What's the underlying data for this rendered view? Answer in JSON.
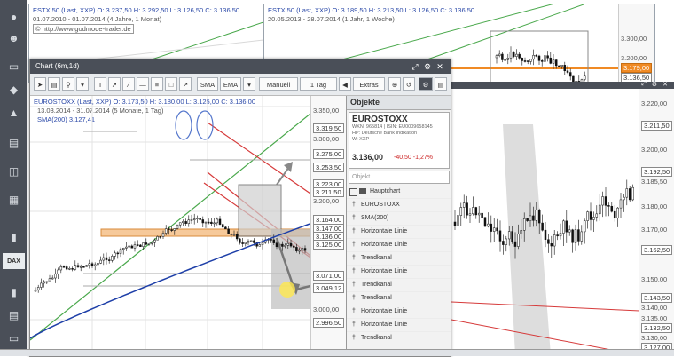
{
  "main_window": {
    "title": "Chart (6m,1d)",
    "toolbar": {
      "sma_label": "SMA",
      "ema_label": "EMA",
      "mode_label": "Manuell",
      "interval_label": "1 Tag",
      "extras_label": "Extras"
    },
    "info": {
      "line1": "EUROSTOXX (Last, XXP) O: 3.173,50 H: 3.180,00 L: 3.125,00 C: 3.136,00",
      "line2": "13.03.2014 - 31.07.2014 (5 Monate, 1 Tag)",
      "line3": "SMA(200)   3.127,41"
    },
    "price_labels": [
      "3.350,00",
      "3.319,50",
      "3.300,00",
      "3.275,00",
      "3.253,50",
      "3.223,00",
      "3.211,50",
      "3.200,00",
      "3.164,00",
      "3.147,00",
      "3.136,00",
      "3.125,00",
      "3.071,00",
      "3.049,12",
      "3.000,00",
      "2.996,50"
    ]
  },
  "objects_panel": {
    "title": "Objekte",
    "symbol": "EUROSTOXX",
    "wkn_line": "WKN: 965814 | ISIN: EU0009658145",
    "hp_line": "HP: Deutsche Bank Indikation",
    "w_line": "W: XXP",
    "price": "3.136,00",
    "change": "-40,50  -1,27%",
    "search_placeholder": "Objekt",
    "tree_root": "Hauptchart",
    "items": [
      "EUROSTOXX",
      "SMA(200)",
      "Horizontale Linie",
      "Horizontale Linie",
      "Trendkanal",
      "Horizontale Linie",
      "Trendkanal",
      "Trendkanal",
      "Horizontale Linie",
      "Horizontale Linie",
      "Trendkanal"
    ]
  },
  "bg_left_window": {
    "info_line1": "ESTX 50 (Last, XXP) O: 3.237,50 H: 3.292,50 L: 3.126,50 C: 3.136,50",
    "info_line2": "01.07.2010 - 01.07.2014 (4 Jahre, 1 Monat)",
    "info_line3": "© http://www.godmode-trader.de"
  },
  "bg_right_window": {
    "info_line1": "ESTX 50 (Last, XXP) O: 3.189,50 H: 3.213,50 L: 3.126,50 C: 3.136,50",
    "info_line2": "20.05.2013 - 28.07.2014 (1 Jahr, 1 Woche)",
    "price_labels": [
      "3.300,00",
      "3.200,00",
      "3.179,00",
      "3.136,50"
    ]
  },
  "bg_intraday_window": {
    "price_labels": [
      "3.220,00",
      "3.211,50",
      "3.200,00",
      "3.192,50",
      "3.185,50",
      "3.180,00",
      "3.170,00",
      "3.162,50",
      "3.150,00",
      "3.143,50",
      "3.140,00",
      "3.135,00",
      "3.132,50",
      "3.130,00",
      "3.127,00"
    ]
  },
  "sidebar_dax": "DAX",
  "colors": {
    "toolbar_dark": "#4a4f58",
    "price_orange": "#f08a24",
    "sma_blue": "#1e3fa8",
    "channel_red": "#d63a3a",
    "channel_green": "#49a84b",
    "change_red": "#cc2222"
  }
}
